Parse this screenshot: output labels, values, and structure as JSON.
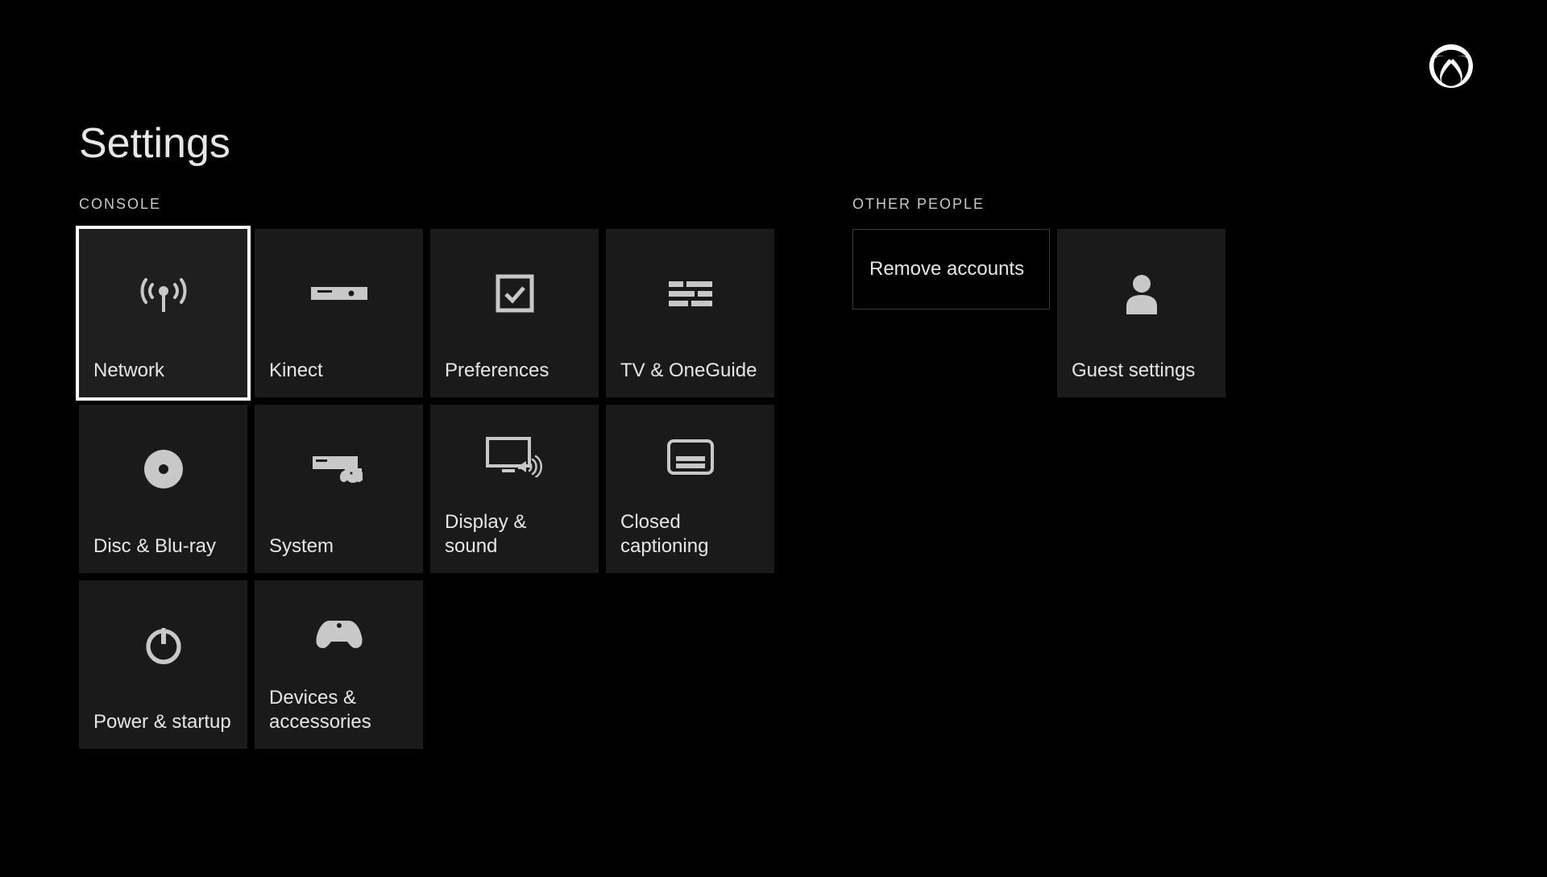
{
  "page_title": "Settings",
  "sections": {
    "console": {
      "label": "CONSOLE",
      "tiles": [
        {
          "id": "network",
          "label": "Network",
          "icon": "network-icon",
          "selected": true
        },
        {
          "id": "kinect",
          "label": "Kinect",
          "icon": "kinect-icon"
        },
        {
          "id": "preferences",
          "label": "Preferences",
          "icon": "preferences-icon"
        },
        {
          "id": "tv-oneguide",
          "label": "TV & OneGuide",
          "icon": "tv-oneguide-icon"
        },
        {
          "id": "disc-bluray",
          "label": "Disc & Blu-ray",
          "icon": "disc-icon"
        },
        {
          "id": "system",
          "label": "System",
          "icon": "system-icon"
        },
        {
          "id": "display-sound",
          "label": "Display & sound",
          "icon": "display-sound-icon"
        },
        {
          "id": "closed-captioning",
          "label": "Closed captioning",
          "icon": "closed-captioning-icon"
        },
        {
          "id": "power-startup",
          "label": "Power & startup",
          "icon": "power-icon"
        },
        {
          "id": "devices-accessories",
          "label": "Devices & accessories",
          "icon": "controller-icon"
        }
      ]
    },
    "other_people": {
      "label": "OTHER PEOPLE",
      "remove_accounts_label": "Remove accounts",
      "guest_settings_label": "Guest settings"
    }
  }
}
